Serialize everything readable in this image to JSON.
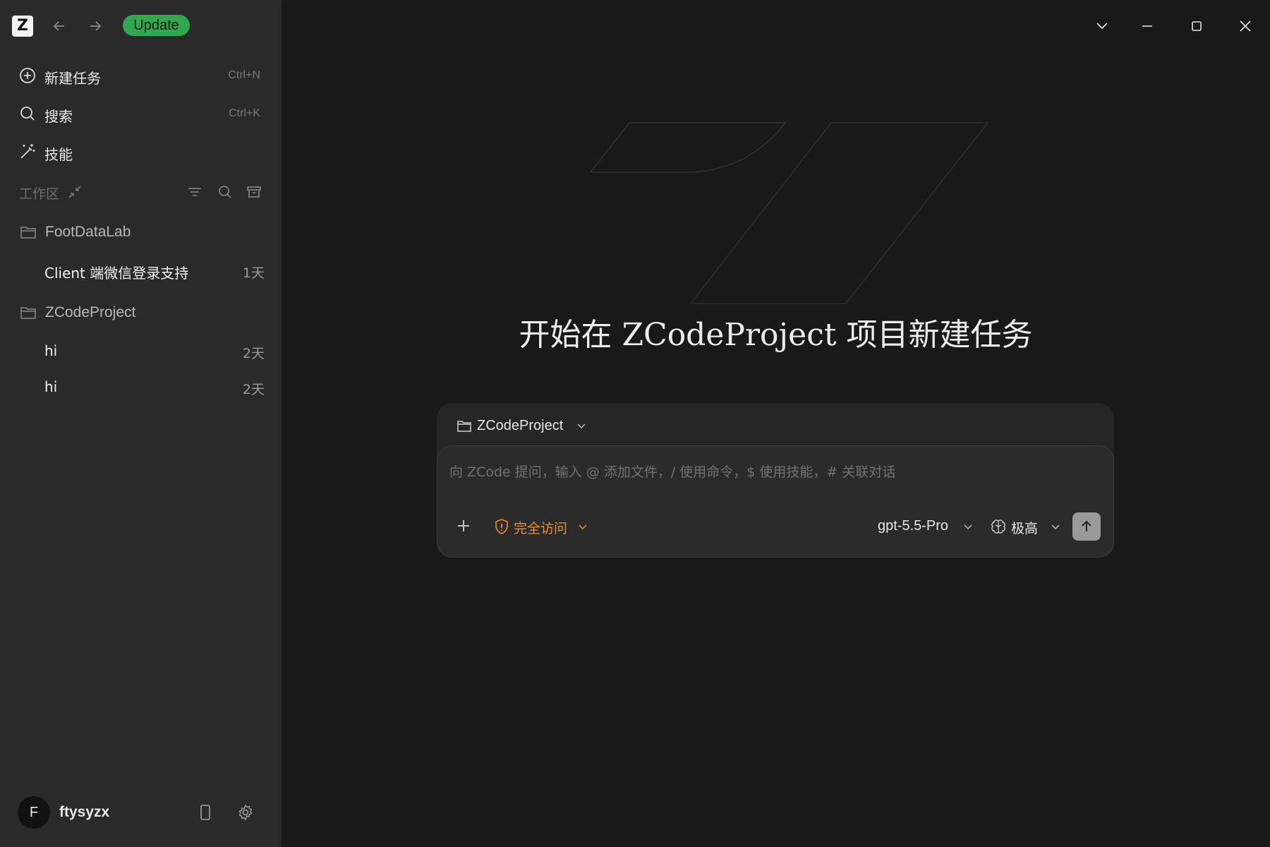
{
  "app": {
    "logo_letter": "Z",
    "update_label": "Update"
  },
  "sidebar": {
    "menu": [
      {
        "label": "新建任务",
        "shortcut": "Ctrl+N",
        "icon": "plus-circle-icon"
      },
      {
        "label": "搜索",
        "shortcut": "Ctrl+K",
        "icon": "search-icon"
      },
      {
        "label": "技能",
        "shortcut": "",
        "icon": "magic-wand-icon"
      }
    ],
    "workspace_label": "工作区",
    "projects": [
      {
        "name": "FootDataLab",
        "tasks": [
          {
            "title": "Client 端微信登录支持",
            "age": "1天"
          }
        ]
      },
      {
        "name": "ZCodeProject",
        "tasks": [
          {
            "title": "hi",
            "age": "2天"
          },
          {
            "title": "hi",
            "age": "2天"
          }
        ]
      }
    ],
    "user": {
      "initial": "F",
      "name": "ftysyzx"
    }
  },
  "main": {
    "headline": "开始在 ZCodeProject 项目新建任务",
    "composer": {
      "project": "ZCodeProject",
      "placeholder": "向 ZCode 提问，输入 @ 添加文件，/ 使用命令，$ 使用技能，# 关联对话",
      "access_label": "完全访问",
      "model": "gpt-5.5-Pro",
      "effort": "极高"
    }
  },
  "colors": {
    "accent_green": "#2fa84f",
    "access_orange": "#f08c2c",
    "sidebar_bg": "#2a2a2a",
    "main_bg": "#191919"
  }
}
